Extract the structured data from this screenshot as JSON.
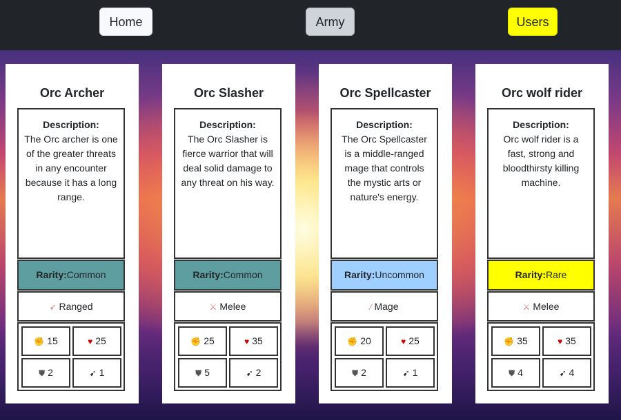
{
  "nav": {
    "home": "Home",
    "army": "Army",
    "users": "Users"
  },
  "labels": {
    "description": "Description:",
    "rarity": "Rarity:"
  },
  "cards": [
    {
      "name": "Orc Archer",
      "description": "The Orc archer is one of the greater threats in any encounter because it has a long range.",
      "rarity": "Common",
      "type": "Ranged",
      "type_icon": "bow-icon",
      "attack": "15",
      "health": "25",
      "defense": "2",
      "speed": "1"
    },
    {
      "name": "Orc Slasher",
      "description": "The Orc Slasher is fierce warrior that will deal solid damage to any threat on his way.",
      "rarity": "Common",
      "type": "Melee",
      "type_icon": "sword-icon",
      "attack": "25",
      "health": "35",
      "defense": "5",
      "speed": "2"
    },
    {
      "name": "Orc Spellcaster",
      "description": "The Orc Spellcaster is a middle-ranged mage that controls the mystic arts or nature's energy.",
      "rarity": "Uncommon",
      "type": "Mage",
      "type_icon": "wand-icon",
      "attack": "20",
      "health": "25",
      "defense": "2",
      "speed": "1"
    },
    {
      "name": "Orc wolf rider",
      "description": "Orc wolf rider is a fast, strong and bloodthirsty killing machine.",
      "rarity": "Rare",
      "type": "Melee",
      "type_icon": "sword-icon",
      "attack": "35",
      "health": "35",
      "defense": "4",
      "speed": "4"
    }
  ],
  "colors": {
    "navbar": "#212529",
    "common": "#5f9ea0",
    "uncommon": "#9fcfff",
    "rare": "#ffff00"
  }
}
